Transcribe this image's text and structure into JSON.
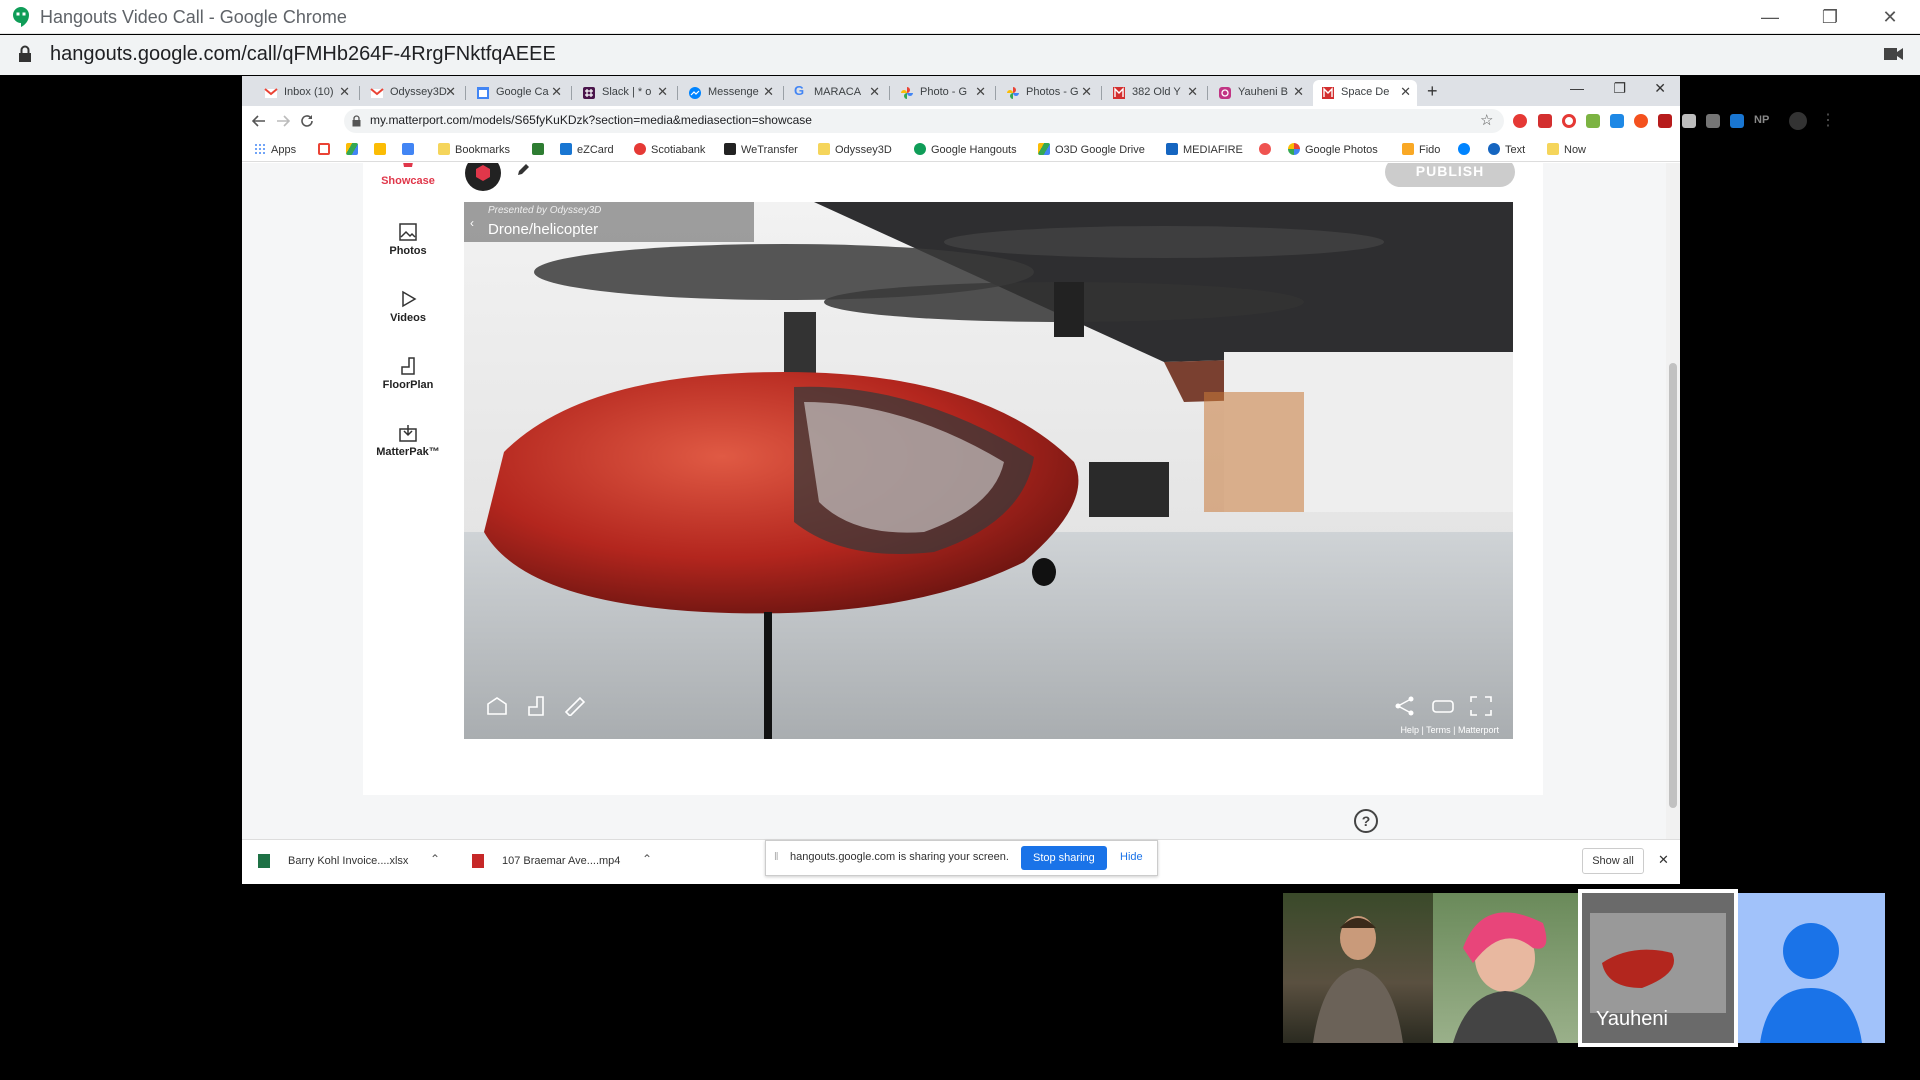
{
  "outer_window": {
    "title": "Hangouts Video Call - Google Chrome",
    "url": "hangouts.google.com/call/qFMHb264F-4RrgFNktfqAEEE",
    "minimize_icon": "minimize-icon",
    "restore_icon": "restore-icon",
    "close_icon": "close-icon"
  },
  "inner_browser": {
    "tabs": [
      {
        "label": "Inbox (10)",
        "icon": "gmail-icon"
      },
      {
        "label": "Odyssey3D",
        "icon": "gmail-icon"
      },
      {
        "label": "Google Ca",
        "icon": "calendar-icon"
      },
      {
        "label": "Slack | * o",
        "icon": "slack-icon"
      },
      {
        "label": "Messenge",
        "icon": "messenger-icon"
      },
      {
        "label": "MARACA",
        "icon": "google-icon"
      },
      {
        "label": "Photo - G",
        "icon": "photos-icon"
      },
      {
        "label": "Photos - G",
        "icon": "photos-icon"
      },
      {
        "label": "382 Old Y",
        "icon": "matterport-icon"
      },
      {
        "label": "Yauheni B",
        "icon": "instagram-icon"
      },
      {
        "label": "Space De",
        "icon": "matterport-icon",
        "active": true
      }
    ],
    "new_tab": "+",
    "url": "my.matterport.com/models/S65fyKuKDzk?section=media&mediasection=showcase",
    "bookmarks": [
      {
        "label": "Apps"
      },
      {
        "label": ""
      },
      {
        "label": ""
      },
      {
        "label": ""
      },
      {
        "label": ""
      },
      {
        "label": "Bookmarks"
      },
      {
        "label": ""
      },
      {
        "label": "eZCard"
      },
      {
        "label": "Scotiabank"
      },
      {
        "label": "WeTransfer"
      },
      {
        "label": "Odyssey3D"
      },
      {
        "label": "Google Hangouts"
      },
      {
        "label": "O3D Google Drive"
      },
      {
        "label": "MEDIAFIRE"
      },
      {
        "label": ""
      },
      {
        "label": "Google Photos"
      },
      {
        "label": "Fido"
      },
      {
        "label": ""
      },
      {
        "label": "Text"
      },
      {
        "label": "Now"
      }
    ],
    "extensions": [
      "NP"
    ]
  },
  "matterport": {
    "sidebar": [
      {
        "label": "Showcase",
        "icon": "showcase-icon"
      },
      {
        "label": "Photos",
        "icon": "photos-icon"
      },
      {
        "label": "Videos",
        "icon": "play-icon"
      },
      {
        "label": "FloorPlan",
        "icon": "floorplan-icon"
      },
      {
        "label": "MatterPak™",
        "icon": "matterpak-icon"
      }
    ],
    "publish_label": "PUBLISH",
    "viewer": {
      "presented_by": "Presented by",
      "presenter": "Odyssey3D",
      "model_title": "Drone/helicopter",
      "footer_links": [
        "Help",
        "Terms",
        "Matterport"
      ]
    },
    "help_icon": "?"
  },
  "download_bar": {
    "items": [
      {
        "name": "Barry Kohl Invoice....xlsx",
        "icon": "excel-icon"
      },
      {
        "name": "107 Braemar Ave....mp4",
        "icon": "video-file-icon"
      }
    ],
    "show_all": "Show all"
  },
  "sharing_banner": {
    "text": "hangouts.google.com is sharing your screen.",
    "stop_label": "Stop sharing",
    "hide_label": "Hide"
  },
  "participants": [
    {
      "name": ""
    },
    {
      "name": ""
    },
    {
      "name": "Yauheni"
    },
    {
      "name": ""
    }
  ],
  "colors": {
    "accent_blue": "#1a73e8",
    "showcase_red": "#e0374a",
    "helicopter_red": "#b3261e"
  }
}
